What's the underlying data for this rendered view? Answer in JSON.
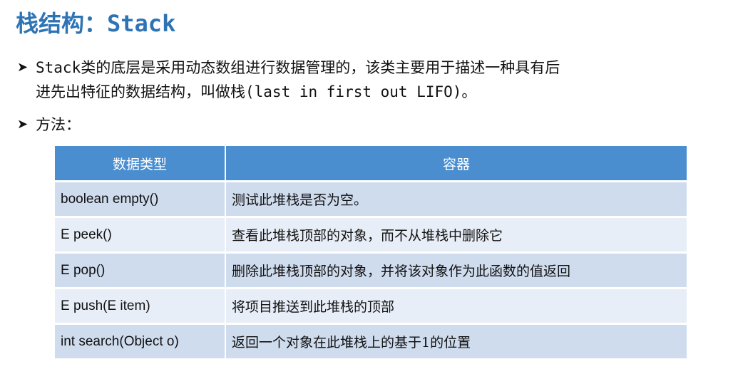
{
  "title": "栈结构：Stack",
  "bullets": [
    {
      "lines": [
        "Stack类的底层是采用动态数组进行数据管理的，该类主要用于描述一种具有后",
        "进先出特征的数据结构，叫做栈(last in first out LIFO)。"
      ]
    },
    {
      "lines": [
        "方法："
      ]
    }
  ],
  "table": {
    "headers": [
      "数据类型",
      "容器"
    ],
    "rows": [
      {
        "sig": "boolean empty()",
        "desc": "测试此堆栈是否为空。"
      },
      {
        "sig": "E peek()",
        "desc": "查看此堆栈顶部的对象，而不从堆栈中删除它"
      },
      {
        "sig": "E pop()",
        "desc": "删除此堆栈顶部的对象，并将该对象作为此函数的值返回"
      },
      {
        "sig": "E push(E item)",
        "desc": "将项目推送到此堆栈的顶部"
      },
      {
        "sig": "int search(Object o)",
        "desc": "返回一个对象在此堆栈上的基于1的位置"
      }
    ]
  },
  "colors": {
    "title": "#2e74b5",
    "header_bg": "#4a8ed0",
    "row_dark": "#cfdcee",
    "row_light": "#e8eef7"
  }
}
